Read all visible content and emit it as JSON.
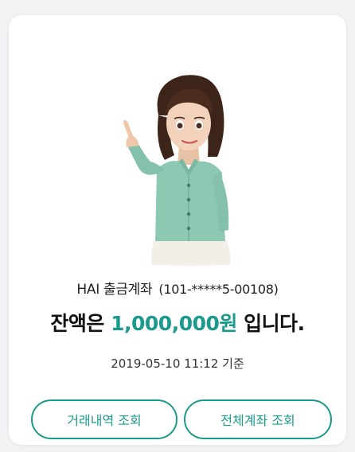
{
  "account": {
    "name": "HAI 출금계좌",
    "number": "(101-*****5-00108)"
  },
  "balance": {
    "prefix": "잔액은",
    "amount": "1,000,000원",
    "suffix": "입니다."
  },
  "timestamp": "2019-05-10 11:12 기준",
  "buttons": {
    "history": "거래내역 조회",
    "all_accounts": "전체계좌 조회"
  },
  "colors": {
    "accent": "#1a9a8c",
    "blouse": "#8cc9b2",
    "skirt": "#f3efe6"
  },
  "illustration": "assistant-woman-pointing-up"
}
